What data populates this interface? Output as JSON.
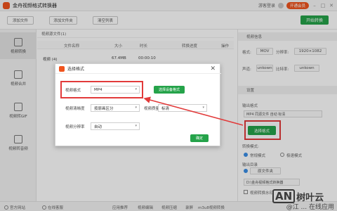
{
  "window": {
    "title": "金舟视频格式转换器",
    "login_text": "游客登录",
    "vip_label": "开通会员",
    "min_icon": "minimize-icon",
    "max_icon": "maximize-icon",
    "close_icon": "close-icon"
  },
  "toolbar": {
    "add_file": "添加文件",
    "add_folder": "添加文件夹",
    "clear_list": "清空列表",
    "start_convert": "开始转换"
  },
  "sidebar": {
    "items": [
      {
        "label": "视频转换",
        "icon": "video-convert-icon",
        "active": true
      },
      {
        "label": "视频合并",
        "icon": "video-merge-icon",
        "active": false
      },
      {
        "label": "视频转GIF",
        "icon": "gif-icon",
        "active": false
      },
      {
        "label": "视频转音频",
        "icon": "audio-icon",
        "active": false
      }
    ]
  },
  "filelist": {
    "header": "视频源文件(1)",
    "columns": [
      "文件名称",
      "大小",
      "时长",
      "转换进度",
      "操作"
    ],
    "rows": [
      {
        "name": "视频 (4)",
        "size": "67.4MB",
        "duration": "00:00:10"
      }
    ]
  },
  "right_panel": {
    "info_header": "视频信息",
    "format_label": "格式:",
    "format_value": "MOV",
    "resolution_label": "分辨率:",
    "resolution_value": "1920×1082",
    "audio_label": "声道:",
    "audio_value": "unkown",
    "bitrate_label": "比特率:",
    "bitrate_value": "unkown",
    "settings_header": "设置",
    "output_format_label": "输出格式",
    "output_format_value": "MP4 同源文件 自动 标清",
    "select_format_button": "选择格式",
    "convert_mode_label": "转换模式:",
    "mode_normal": "常规模式",
    "mode_fast": "极速模式",
    "output_dir_label": "输出目录",
    "output_dir_button": "原文件夹",
    "output_path": "D:\\金舟视频格式转换器",
    "watermark_check": "视频转换水印"
  },
  "dialog": {
    "title": "选择格式",
    "video_format_label": "视频格式",
    "video_format_value": "MP4",
    "select_device_button": "选择设备格式",
    "clarity_label": "视频清晰度",
    "clarity_value": "按原画区分",
    "quality_label": "视频质量",
    "quality_value": "标清",
    "resolution_label": "视频分辨率",
    "resolution_value": "自动",
    "ok_button": "确定"
  },
  "statusbar": {
    "items": [
      "官方网站",
      "在线客服",
      "应用推荐",
      "视频编辑",
      "视频压缩",
      "录屏",
      "m3u8视频转换"
    ]
  },
  "watermark": {
    "logo": "AN",
    "text": "树叶云",
    "bottom_text": "@江 ... 在线应用"
  },
  "colors": {
    "accent_green": "#25a34a",
    "brand_orange": "#f0541e",
    "annotation_red": "#e23a3a"
  }
}
